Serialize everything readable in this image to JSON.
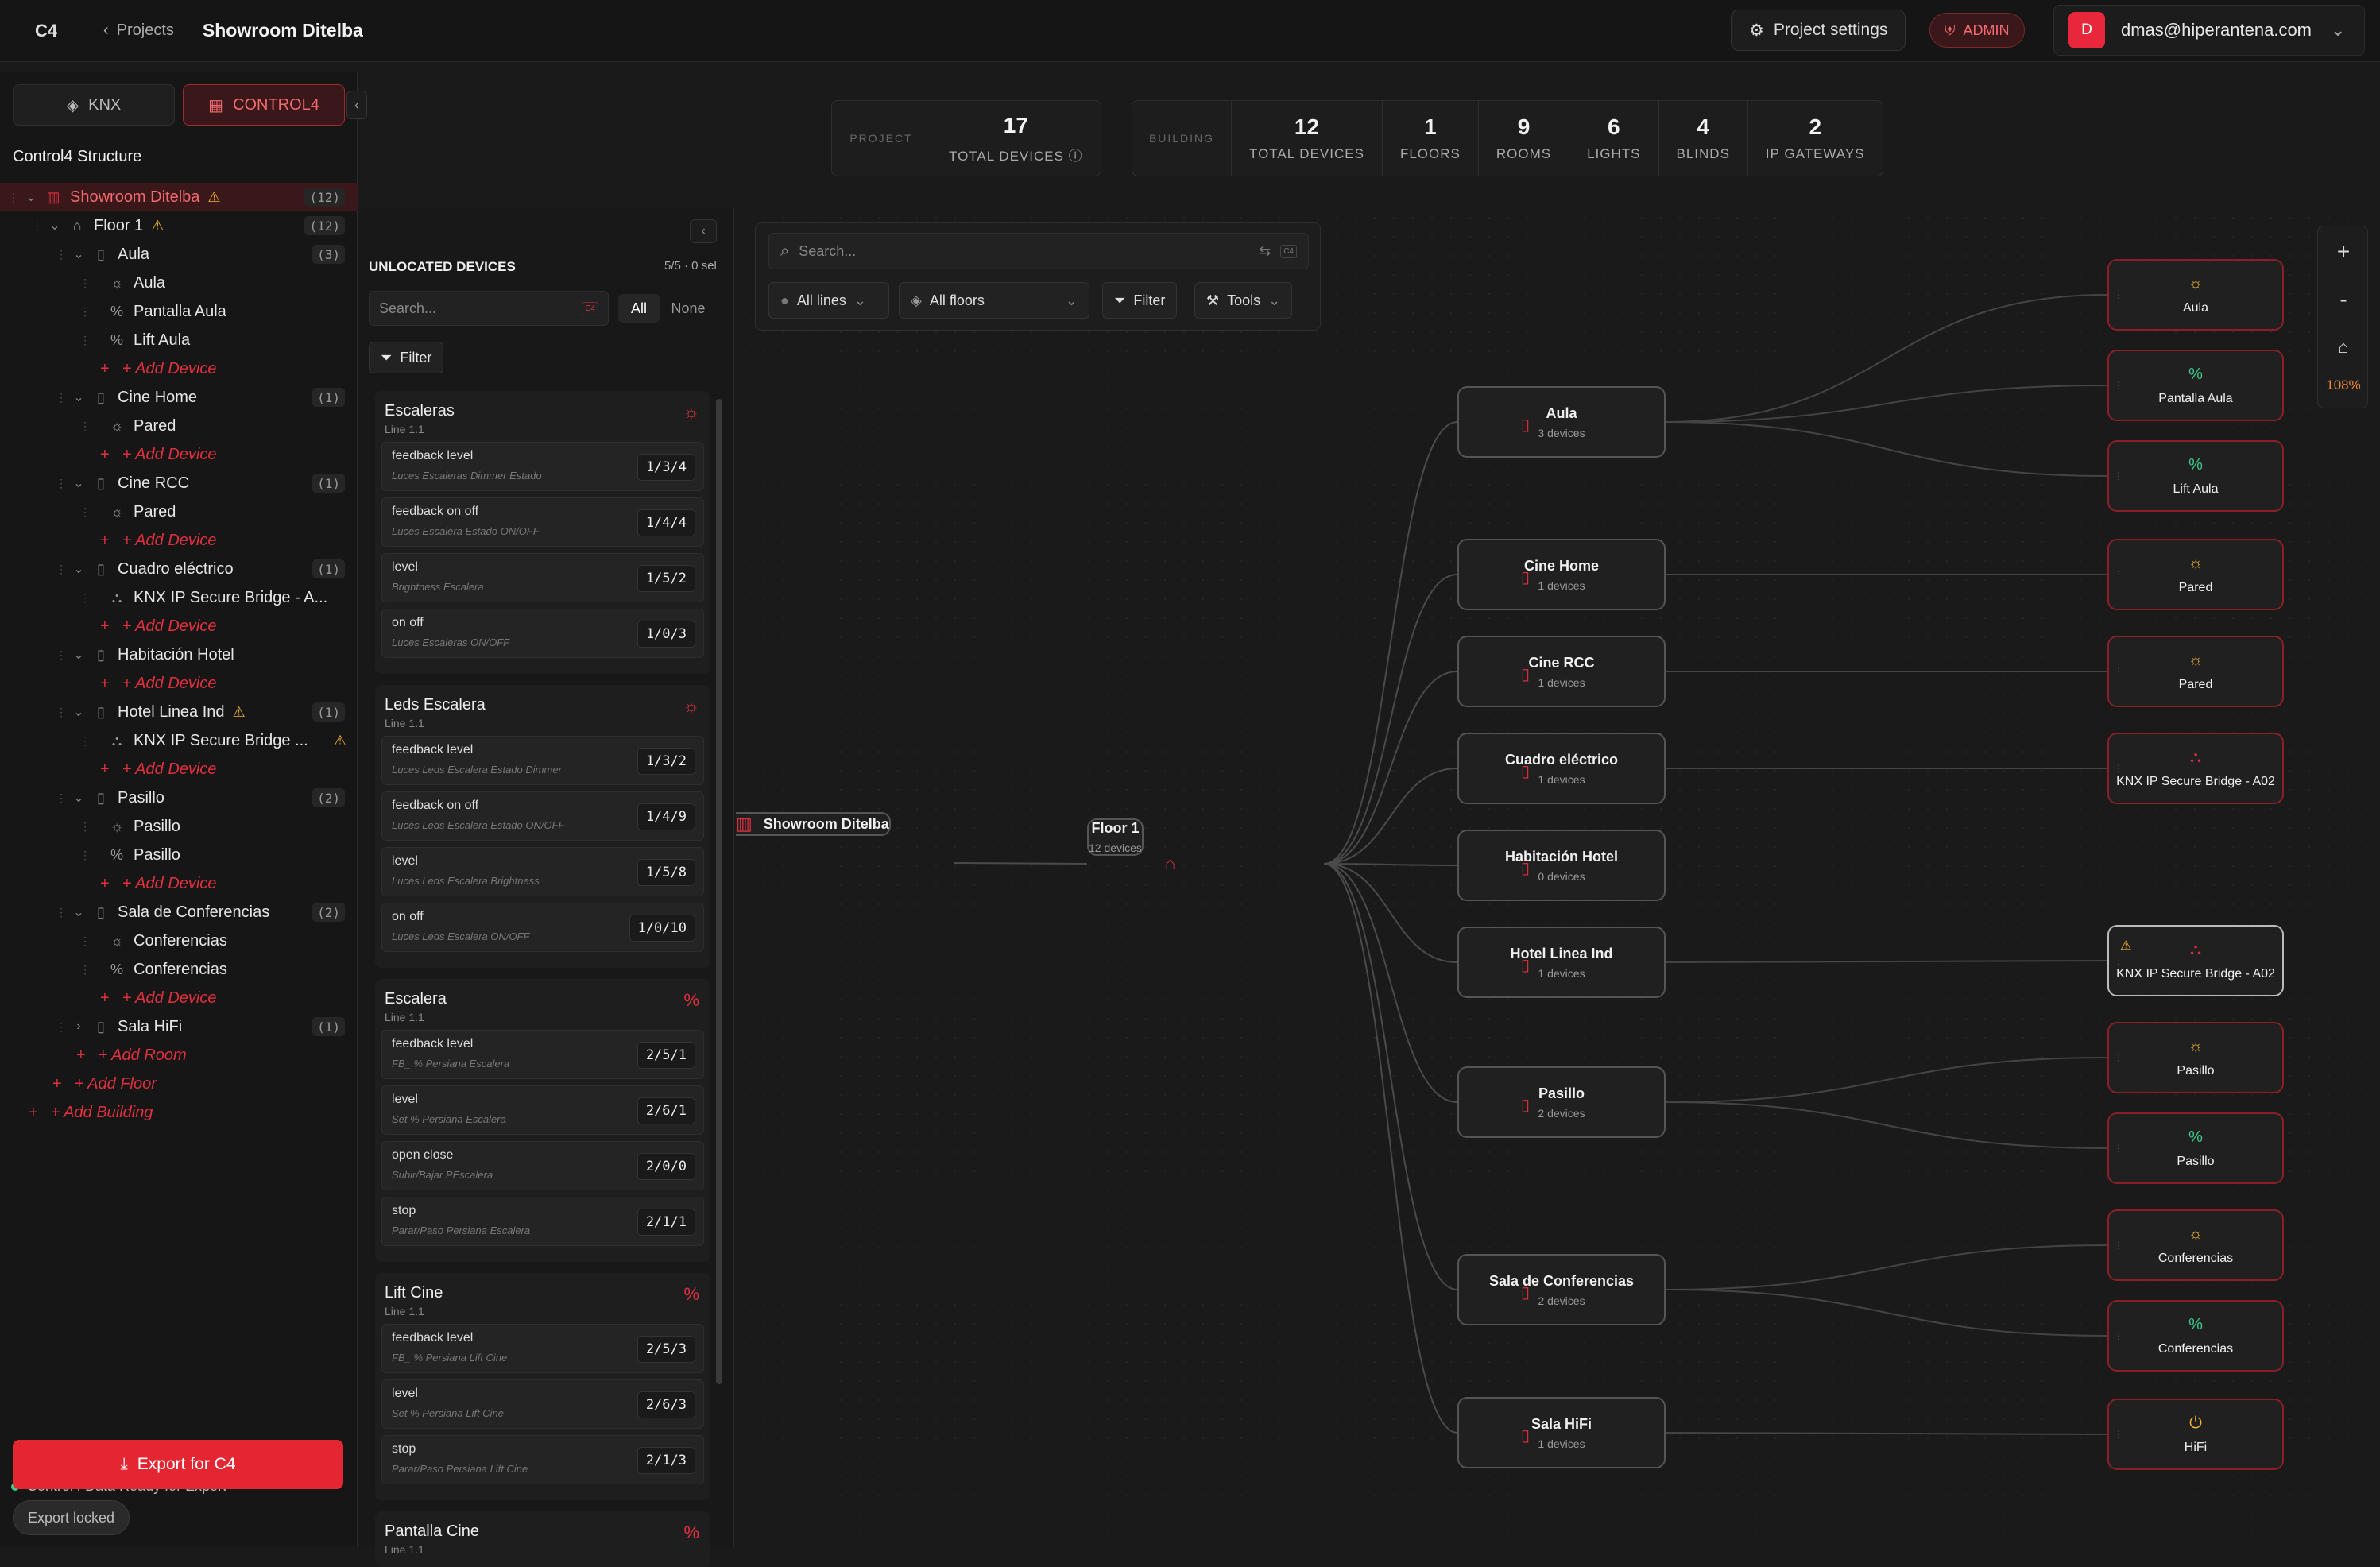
{
  "topbar": {
    "logo": "C4",
    "back_label": "Projects",
    "project_title": "Showroom Ditelba",
    "settings_label": "Project settings",
    "role_label": "ADMIN",
    "user_initial": "D",
    "user_email": "dmas@hiperantena.com"
  },
  "modes": {
    "knx": "KNX",
    "control4": "CONTROL4"
  },
  "tree": {
    "heading": "Control4 Structure",
    "rows": [
      {
        "label": "Showroom Ditelba",
        "count": "(12)"
      },
      {
        "label": "Floor 1",
        "count": "(12)"
      },
      {
        "label": "Aula",
        "count": "(3)"
      },
      {
        "label": "Aula"
      },
      {
        "label": "Pantalla Aula"
      },
      {
        "label": "Lift Aula"
      },
      {
        "label": "+ Add Device"
      },
      {
        "label": "Cine Home",
        "count": "(1)"
      },
      {
        "label": "Pared"
      },
      {
        "label": "+ Add Device"
      },
      {
        "label": "Cine RCC",
        "count": "(1)"
      },
      {
        "label": "Pared"
      },
      {
        "label": "+ Add Device"
      },
      {
        "label": "Cuadro eléctrico",
        "count": "(1)"
      },
      {
        "label": "KNX IP Secure Bridge - A..."
      },
      {
        "label": "+ Add Device"
      },
      {
        "label": "Habitación Hotel"
      },
      {
        "label": "+ Add Device"
      },
      {
        "label": "Hotel Linea Ind",
        "count": "(1)"
      },
      {
        "label": "KNX IP Secure Bridge ..."
      },
      {
        "label": "+ Add Device"
      },
      {
        "label": "Pasillo",
        "count": "(2)"
      },
      {
        "label": "Pasillo"
      },
      {
        "label": "Pasillo"
      },
      {
        "label": "+ Add Device"
      },
      {
        "label": "Sala de Conferencias",
        "count": "(2)"
      },
      {
        "label": "Conferencias"
      },
      {
        "label": "Conferencias"
      },
      {
        "label": "+ Add Device"
      },
      {
        "label": "Sala HiFi",
        "count": "(1)"
      },
      {
        "label": "+ Add Room"
      },
      {
        "label": "+ Add Floor"
      },
      {
        "label": "+ Add Building"
      }
    ]
  },
  "export": {
    "ready": "Control4 Data Ready for Export",
    "button": "Export for C4",
    "locked": "Export locked"
  },
  "unlocated": {
    "title": "UNLOCATED DEVICES",
    "summary": "5/5 · 0 sel",
    "search_placeholder": "Search...",
    "c4_badge": "C4",
    "all": "All",
    "none": "None",
    "filter": "Filter",
    "groups": [
      {
        "name": "Escaleras",
        "line": "Line 1.1",
        "icon": "☼",
        "objects": [
          {
            "name": "feedback level",
            "desc": "Luces Escaleras Dimmer Estado",
            "addr": "1/3/4"
          },
          {
            "name": "feedback on off",
            "desc": "Luces Escalera Estado ON/OFF",
            "addr": "1/4/4"
          },
          {
            "name": "level",
            "desc": "Brightness Escalera",
            "addr": "1/5/2"
          },
          {
            "name": "on off",
            "desc": "Luces Escaleras ON/OFF",
            "addr": "1/0/3"
          }
        ]
      },
      {
        "name": "Leds Escalera",
        "line": "Line 1.1",
        "icon": "☼",
        "objects": [
          {
            "name": "feedback level",
            "desc": "Luces Leds Escalera Estado Dimmer",
            "addr": "1/3/2"
          },
          {
            "name": "feedback on off",
            "desc": "Luces Leds Escalera Estado ON/OFF",
            "addr": "1/4/9"
          },
          {
            "name": "level",
            "desc": "Luces Leds Escalera Brightness",
            "addr": "1/5/8"
          },
          {
            "name": "on off",
            "desc": "Luces Leds Escalera ON/OFF",
            "addr": "1/0/10"
          }
        ]
      },
      {
        "name": "Escalera",
        "line": "Line 1.1",
        "icon": "%",
        "objects": [
          {
            "name": "feedback level",
            "desc": "FB_ % Persiana Escalera",
            "addr": "2/5/1"
          },
          {
            "name": "level",
            "desc": "Set % Persiana Escalera",
            "addr": "2/6/1"
          },
          {
            "name": "open close",
            "desc": "Subir/Bajar PEscalera",
            "addr": "2/0/0"
          },
          {
            "name": "stop",
            "desc": "Parar/Paso Persiana Escalera",
            "addr": "2/1/1"
          }
        ]
      },
      {
        "name": "Lift Cine",
        "line": "Line 1.1",
        "icon": "%",
        "objects": [
          {
            "name": "feedback level",
            "desc": "FB_ % Persiana Lift Cine",
            "addr": "2/5/3"
          },
          {
            "name": "level",
            "desc": "Set % Persiana Lift Cine",
            "addr": "2/6/3"
          },
          {
            "name": "stop",
            "desc": "Parar/Paso Persiana Lift Cine",
            "addr": "2/1/3"
          }
        ]
      },
      {
        "name": "Pantalla Cine",
        "line": "Line 1.1",
        "icon": "%",
        "objects": []
      }
    ]
  },
  "stats": {
    "project_label": "PROJECT",
    "project_total": "17",
    "project_total_label": "TOTAL DEVICES ⓘ",
    "building_label": "BUILDING",
    "items": [
      {
        "n": "12",
        "l": "TOTAL DEVICES"
      },
      {
        "n": "1",
        "l": "FLOORS"
      },
      {
        "n": "9",
        "l": "ROOMS"
      },
      {
        "n": "6",
        "l": "LIGHTS"
      },
      {
        "n": "4",
        "l": "BLINDS"
      },
      {
        "n": "2",
        "l": "IP GATEWAYS"
      }
    ]
  },
  "toolbar": {
    "search_placeholder": "Search...",
    "c4_badge": "C4",
    "lines": "All lines",
    "floors": "All floors",
    "filter": "Filter",
    "tools": "Tools"
  },
  "zoom": {
    "plus": "+",
    "minus": "-",
    "home": "⌂",
    "level": "108%"
  },
  "graph": {
    "building": {
      "name": "Showroom Ditelba"
    },
    "floor": {
      "name": "Floor 1",
      "sub": "12 devices"
    },
    "rooms": [
      {
        "name": "Aula",
        "sub": "3 devices"
      },
      {
        "name": "Cine Home",
        "sub": "1 devices"
      },
      {
        "name": "Cine RCC",
        "sub": "1 devices"
      },
      {
        "name": "Cuadro eléctrico",
        "sub": "1 devices"
      },
      {
        "name": "Habitación Hotel",
        "sub": "0 devices"
      },
      {
        "name": "Hotel Linea Ind",
        "sub": "1 devices"
      },
      {
        "name": "Pasillo",
        "sub": "2 devices"
      },
      {
        "name": "Sala de Conferencias",
        "sub": "2 devices"
      },
      {
        "name": "Sala HiFi",
        "sub": "1 devices"
      }
    ],
    "devices": [
      {
        "name": "Aula",
        "icon": "☼"
      },
      {
        "name": "Pantalla Aula",
        "icon": "%"
      },
      {
        "name": "Lift Aula",
        "icon": "%"
      },
      {
        "name": "Pared",
        "icon": "☼"
      },
      {
        "name": "Pared",
        "icon": "☼"
      },
      {
        "name": "KNX IP Secure Bridge - A02",
        "icon": "⛬"
      },
      {
        "name": "KNX IP Secure Bridge - A02",
        "icon": "⛬"
      },
      {
        "name": "Pasillo",
        "icon": "☼"
      },
      {
        "name": "Pasillo",
        "icon": "%"
      },
      {
        "name": "Conferencias",
        "icon": "☼"
      },
      {
        "name": "Conferencias",
        "icon": "%"
      },
      {
        "name": "HiFi",
        "icon": "⏻"
      }
    ]
  },
  "colors": {
    "accent": "#e42532",
    "warning": "#f0b232",
    "light": "#f0b232",
    "blind": "#3ec98a"
  }
}
